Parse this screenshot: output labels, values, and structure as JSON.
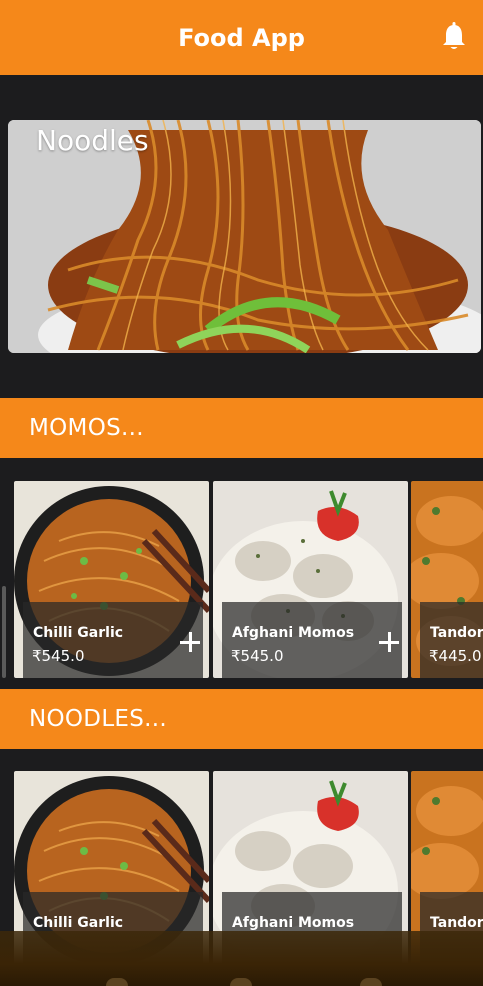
{
  "app_bar": {
    "title": "Food App",
    "notification_icon": "bell-icon"
  },
  "hero": {
    "title": "Noodles"
  },
  "sections": [
    {
      "title": "MOMOS...",
      "items": [
        {
          "name": "Chilli Garlic",
          "price": "₹545.0"
        },
        {
          "name": "Afghani Momos",
          "price": "₹545.0"
        },
        {
          "name": "Tandori",
          "price": "₹445.0"
        }
      ]
    },
    {
      "title": "NOODLES...",
      "items": [
        {
          "name": "Chilli Garlic",
          "price": ""
        },
        {
          "name": "Afghani Momos",
          "price": ""
        },
        {
          "name": "Tandori",
          "price": ""
        }
      ]
    }
  ],
  "colors": {
    "accent": "#f5881a",
    "background": "#1c1c1e"
  }
}
